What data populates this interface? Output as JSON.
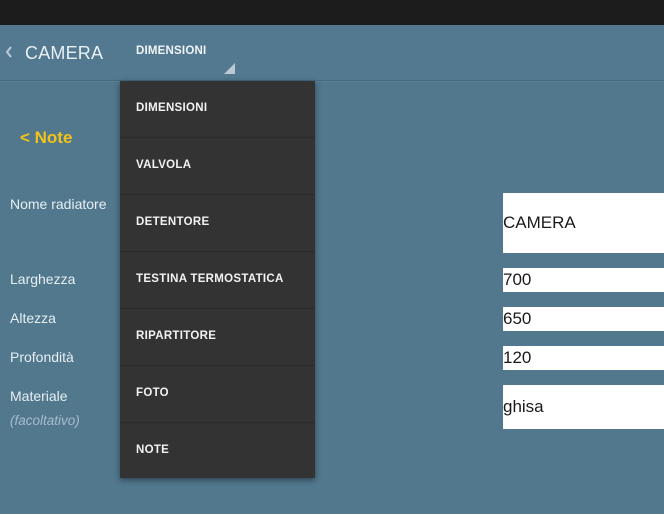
{
  "action_bar": {
    "title": "CAMERA",
    "up_icon": "chevron-left-icon",
    "spinner_selected": "DIMENSIONI",
    "spinner_icon": "spinner-corner-triangle-icon"
  },
  "back_link": "< Note",
  "form": {
    "fields": [
      {
        "label": "Nome radiatore",
        "value": "CAMERA"
      },
      {
        "label": "Larghezza",
        "value": "700"
      },
      {
        "label": "Altezza",
        "value": "650"
      },
      {
        "label": "Profondità",
        "value": "120"
      },
      {
        "label": "Materiale",
        "sublabel": "(facoltativo)",
        "value": "ghisa"
      }
    ]
  },
  "dropdown": {
    "items": [
      {
        "label": "DIMENSIONI"
      },
      {
        "label": "VALVOLA"
      },
      {
        "label": "DETENTORE"
      },
      {
        "label": "TESTINA TERMOSTATICA"
      },
      {
        "label": "RIPARTITORE"
      },
      {
        "label": "FOTO"
      },
      {
        "label": "NOTE"
      }
    ]
  },
  "colors": {
    "background": "#52788e",
    "status_bar": "#1c1c1c",
    "accent_link": "#f2c318",
    "dropdown_bg": "#333333"
  }
}
